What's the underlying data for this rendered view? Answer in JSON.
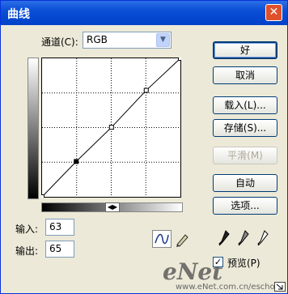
{
  "window": {
    "title": "曲线",
    "close_glyph": "✕"
  },
  "channel": {
    "label": "通道(C):",
    "value": "RGB",
    "arrow": "▼"
  },
  "curve": {
    "points": [
      [
        0,
        0
      ],
      [
        63,
        65
      ],
      [
        128,
        128
      ],
      [
        192,
        196
      ],
      [
        255,
        255
      ]
    ],
    "selected_point": [
      63,
      65
    ],
    "grid_divisions": 4,
    "line_color": "#000000"
  },
  "gradient_toggle": "◀▶",
  "input": {
    "label": "输入:",
    "value": "63"
  },
  "output": {
    "label": "输出:",
    "value": "65"
  },
  "tools": {
    "curve_tool": "curve-icon",
    "pencil_tool": "pencil-icon"
  },
  "buttons": {
    "ok": "好",
    "cancel": "取消",
    "load": "载入(L)...",
    "save": "存储(S)...",
    "smooth": "平滑(M)",
    "auto": "自动",
    "options": "选项..."
  },
  "eyedroppers": [
    "black-eyedropper-icon",
    "gray-eyedropper-icon",
    "white-eyedropper-icon"
  ],
  "preview": {
    "label": "预览(P)",
    "checked": true,
    "check_glyph": "✓"
  },
  "watermark": {
    "logo": "eNet",
    "url": "www.eNet.com.cn/eschool"
  }
}
